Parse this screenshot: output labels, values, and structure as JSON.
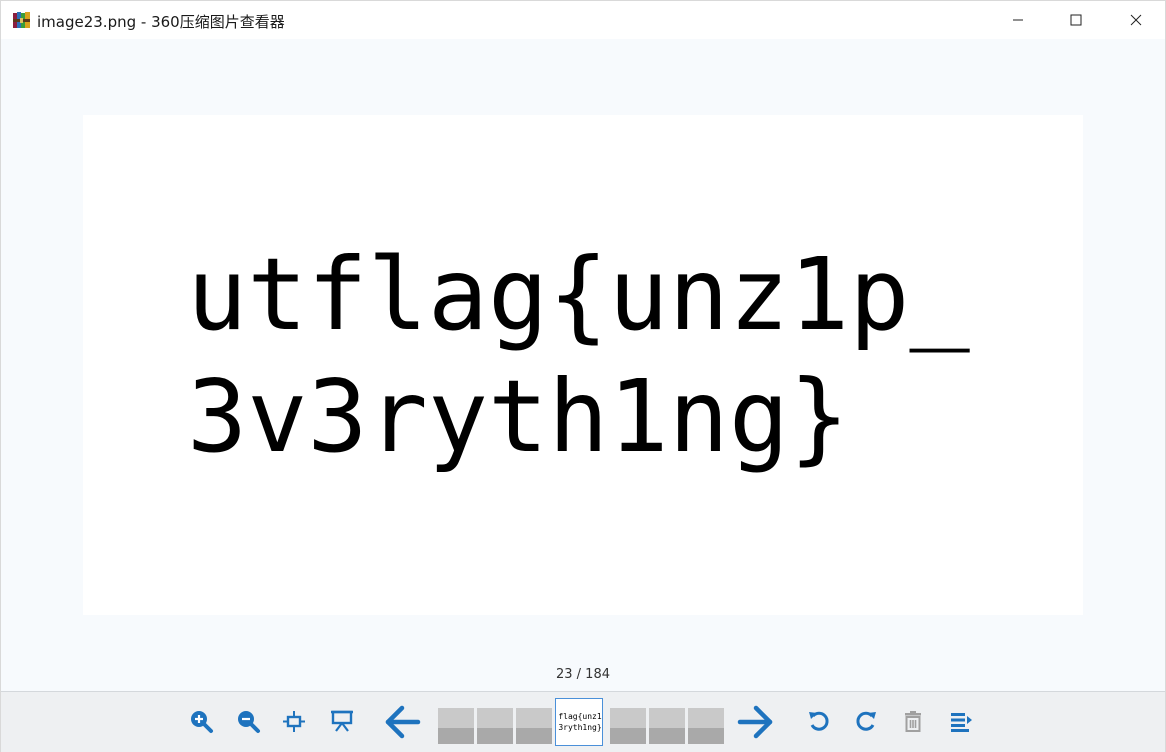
{
  "window": {
    "title": "image23.png - 360压缩图片查看器",
    "app_icon": "archive-books-icon"
  },
  "image": {
    "line1": "utflag{unz1p_",
    "line2": "3v3ryth1ng}"
  },
  "status": {
    "page_counter": "23 / 184"
  },
  "toolbar": {
    "buttons": [
      "zoom-in-icon",
      "zoom-out-icon",
      "fit-window-icon",
      "slideshow-icon",
      "previous-arrow-icon",
      "next-arrow-icon",
      "rotate-left-icon",
      "rotate-right-icon",
      "delete-icon",
      "menu-list-icon"
    ],
    "current_thumb": {
      "line1": "flag{unz1",
      "line2": "3ryth1ng}"
    }
  },
  "colors": {
    "accent": "#1e73be",
    "disabled": "#a0a0a0",
    "background": "#f7fafd",
    "toolbar": "#eef0f2"
  }
}
